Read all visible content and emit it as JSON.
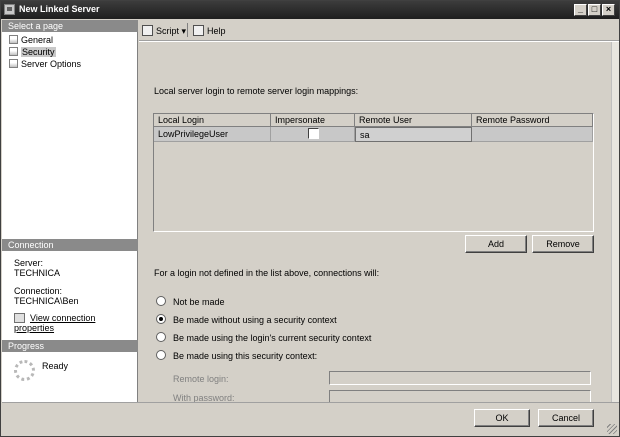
{
  "window": {
    "title": "New Linked Server"
  },
  "sidebar": {
    "select_page_header": "Select a page",
    "pages": [
      "General",
      "Security",
      "Server Options"
    ],
    "selected": "Security",
    "connection_header": "Connection",
    "server_label": "Server:",
    "server_value": "TECHNICA",
    "connection_label": "Connection:",
    "connection_value": "TECHNICA\\Ben",
    "view_link": "View connection properties",
    "progress_header": "Progress",
    "progress_status": "Ready"
  },
  "toolbar": {
    "script_label": "Script",
    "help_label": "Help"
  },
  "main": {
    "mappings_label": "Local server login to remote server login mappings:",
    "grid": {
      "columns": [
        "Local Login",
        "Impersonate",
        "Remote User",
        "Remote Password"
      ],
      "rows": [
        {
          "local_login": "LowPrivilegeUser",
          "impersonate": false,
          "remote_user": "sa",
          "remote_password": ""
        }
      ]
    },
    "add_button": "Add",
    "remove_button": "Remove",
    "not_defined_label": "For a login not defined in the list above, connections will:",
    "options": [
      "Not be made",
      "Be made without using a security context",
      "Be made using the login's current security context",
      "Be made using this security context:"
    ],
    "selected_option": 1,
    "remote_login_label": "Remote login:",
    "with_password_label": "With password:",
    "remote_login_value": "",
    "with_password_value": ""
  },
  "footer": {
    "ok_button": "OK",
    "cancel_button": "Cancel"
  }
}
